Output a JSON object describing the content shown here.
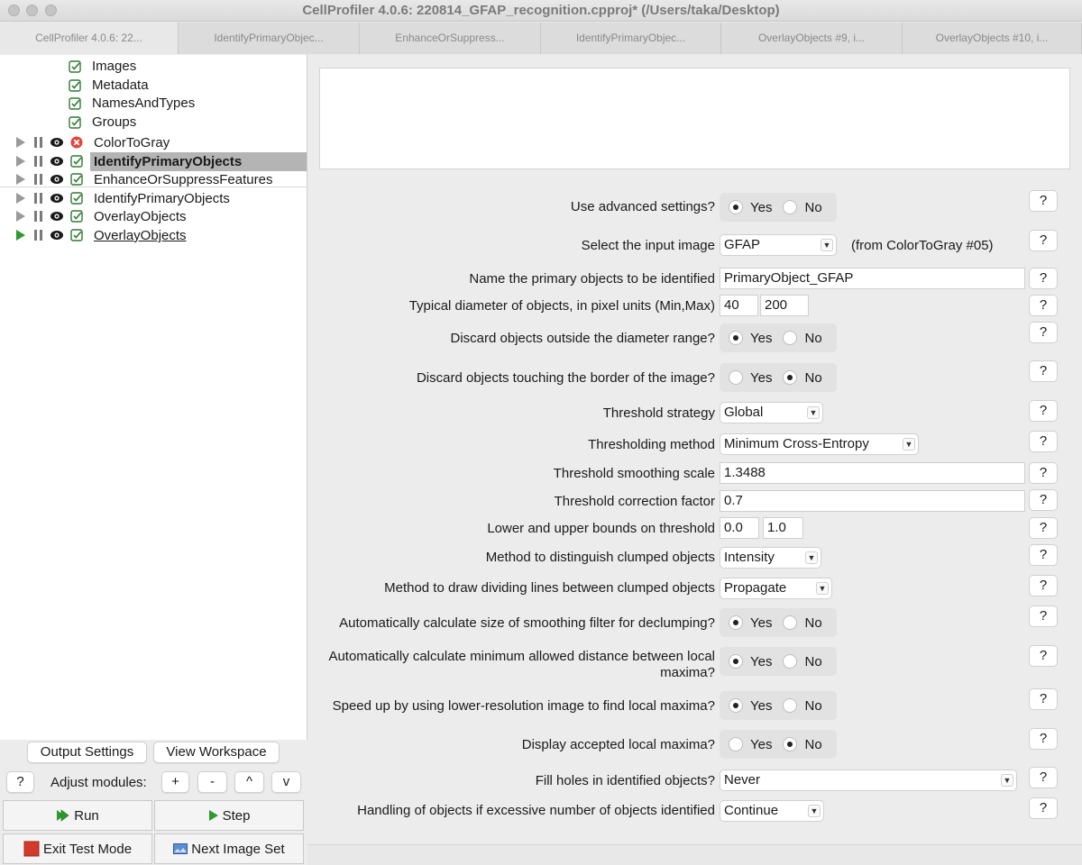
{
  "window": {
    "title": "CellProfiler 4.0.6: 220814_GFAP_recognition.cpproj* (/Users/taka/Desktop)"
  },
  "tabs": [
    {
      "label": "CellProfiler 4.0.6: 22..."
    },
    {
      "label": "IdentifyPrimaryObjec..."
    },
    {
      "label": "EnhanceOrSuppress..."
    },
    {
      "label": "IdentifyPrimaryObjec..."
    },
    {
      "label": "OverlayObjects #9, i..."
    },
    {
      "label": "OverlayObjects #10, i..."
    }
  ],
  "input_modules": [
    {
      "label": "Images"
    },
    {
      "label": "Metadata"
    },
    {
      "label": "NamesAndTypes"
    },
    {
      "label": "Groups"
    }
  ],
  "pipeline_modules": [
    {
      "label": "ColorToGray",
      "status": "error"
    },
    {
      "label": "IdentifyPrimaryObjects",
      "status": "ok",
      "selected": true
    },
    {
      "label": "EnhanceOrSuppressFeatures",
      "status": "ok"
    },
    {
      "label": "IdentifyPrimaryObjects",
      "status": "ok"
    },
    {
      "label": "OverlayObjects",
      "status": "ok"
    },
    {
      "label": "OverlayObjects",
      "status": "ok",
      "current": true
    }
  ],
  "controls": {
    "output_settings": "Output Settings",
    "view_workspace": "View Workspace",
    "help": "?",
    "adjust_label": "Adjust modules:",
    "add": "+",
    "remove": "-",
    "up": "^",
    "down": "v",
    "run": "Run",
    "step": "Step",
    "exit_test": "Exit Test Mode",
    "next_image_set": "Next Image Set"
  },
  "settings": {
    "help": "?",
    "yes": "Yes",
    "no": "No",
    "advanced": {
      "label": "Use advanced settings?",
      "value": "Yes"
    },
    "input_image": {
      "label": "Select the input image",
      "value": "GFAP",
      "from": "(from ColorToGray #05)"
    },
    "object_name": {
      "label": "Name the primary objects to be identified",
      "value": "PrimaryObject_GFAP"
    },
    "diameter": {
      "label": "Typical diameter of objects, in pixel units (Min,Max)",
      "min": "40",
      "max": "200"
    },
    "discard_outside": {
      "label": "Discard objects outside the diameter range?",
      "value": "Yes"
    },
    "discard_border": {
      "label": "Discard objects touching the border of the image?",
      "value": "No"
    },
    "threshold_strategy": {
      "label": "Threshold strategy",
      "value": "Global"
    },
    "threshold_method": {
      "label": "Thresholding method",
      "value": "Minimum Cross-Entropy"
    },
    "smoothing_scale": {
      "label": "Threshold smoothing scale",
      "value": "1.3488"
    },
    "correction_factor": {
      "label": "Threshold correction factor",
      "value": "0.7"
    },
    "bounds": {
      "label": "Lower and upper bounds on threshold",
      "lower": "0.0",
      "upper": "1.0"
    },
    "clump_method": {
      "label": "Method to distinguish clumped objects",
      "value": "Intensity"
    },
    "divide_method": {
      "label": "Method to draw dividing lines between clumped objects",
      "value": "Propagate"
    },
    "auto_smoothing": {
      "label": "Automatically calculate size of smoothing filter for declumping?",
      "value": "Yes"
    },
    "auto_min_distance": {
      "label_line1": "Automatically calculate minimum allowed distance between local",
      "label_line2": "maxima?",
      "value": "Yes"
    },
    "low_res": {
      "label": "Speed up by using lower-resolution image to find local maxima?",
      "value": "Yes"
    },
    "display_maxima": {
      "label": "Display accepted local maxima?",
      "value": "No"
    },
    "fill_holes": {
      "label": "Fill holes in identified objects?",
      "value": "Never"
    },
    "excessive": {
      "label": "Handling of objects if excessive number of objects identified",
      "value": "Continue"
    }
  },
  "colors": {
    "error_icon": "#e0463c",
    "ok_icon": "#2f7a32",
    "play_green": "#2e9a2e",
    "stop_red": "#d23b2b",
    "selected_row": "#b4b4b4"
  }
}
